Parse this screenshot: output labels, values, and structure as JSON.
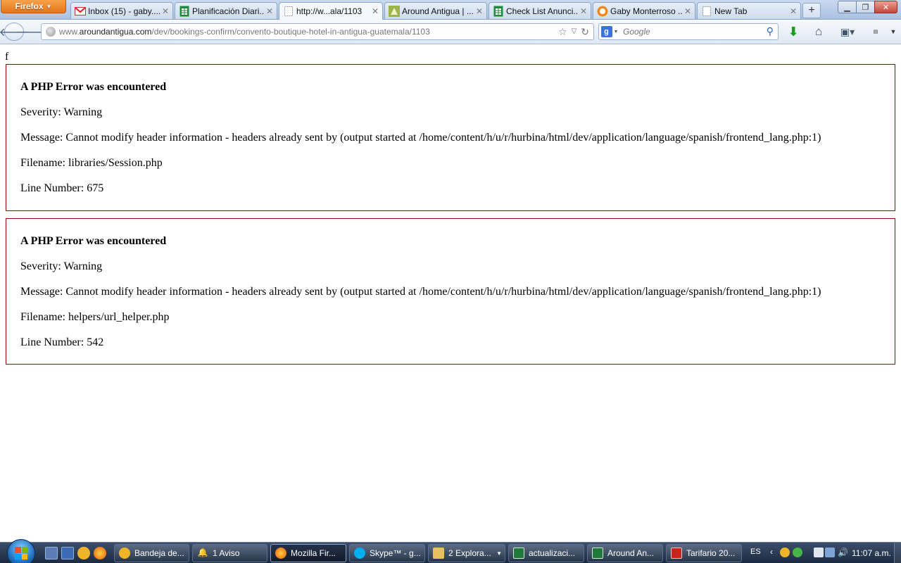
{
  "browser": {
    "menu_button": "Firefox",
    "tabs": [
      {
        "label": "Inbox (15) - gaby....",
        "icon": "gmail-icon"
      },
      {
        "label": "Planificación Diari...",
        "icon": "spreadsheet-icon"
      },
      {
        "label": "http://w...ala/1103",
        "icon": "blank-page-icon",
        "active": true
      },
      {
        "label": "Around Antigua | ...",
        "icon": "site-favicon-icon"
      },
      {
        "label": "Check List Anunci...",
        "icon": "spreadsheet-icon"
      },
      {
        "label": "Gaby Monterroso ...",
        "icon": "chat-icon"
      },
      {
        "label": "New Tab",
        "icon": "blank-page-icon"
      }
    ],
    "new_tab": "+",
    "url": {
      "prefix": "www.",
      "domain": "aroundantigua.com",
      "path": "/dev/bookings-confirm/convento-boutique-hotel-in-antigua-guatemala/1103"
    },
    "search_placeholder": "Google"
  },
  "page": {
    "stray_output": "f",
    "errors": [
      {
        "heading": "A PHP Error was encountered",
        "severity": "Severity: Warning",
        "message": "Message: Cannot modify header information - headers already sent by (output started at /home/content/h/u/r/hurbina/html/dev/application/language/spanish/frontend_lang.php:1)",
        "filename": "Filename: libraries/Session.php",
        "line": "Line Number: 675"
      },
      {
        "heading": "A PHP Error was encountered",
        "severity": "Severity: Warning",
        "message": "Message: Cannot modify header information - headers already sent by (output started at /home/content/h/u/r/hurbina/html/dev/application/language/spanish/frontend_lang.php:1)",
        "filename": "Filename: helpers/url_helper.php",
        "line": "Line Number: 542"
      }
    ]
  },
  "taskbar": {
    "items": [
      {
        "label": "Bandeja de...",
        "icon": "mail-icon"
      },
      {
        "label": "1 Aviso",
        "icon": "bell-icon"
      },
      {
        "label": "Mozilla Fir...",
        "icon": "firefox-icon",
        "active": true
      },
      {
        "label": "Skype™ - g...",
        "icon": "skype-icon"
      },
      {
        "label": "2 Explora...",
        "icon": "folder-icon"
      },
      {
        "label": "actualizaci...",
        "icon": "excel-icon"
      },
      {
        "label": "Around An...",
        "icon": "excel-icon"
      },
      {
        "label": "Tarifario 20...",
        "icon": "pdf-icon"
      }
    ],
    "language": "ES",
    "clock": "11:07 a.m."
  },
  "colors": {
    "error_border": "#990000",
    "firefox_orange": "#e3741c",
    "taskbar": "#1c2a40"
  }
}
